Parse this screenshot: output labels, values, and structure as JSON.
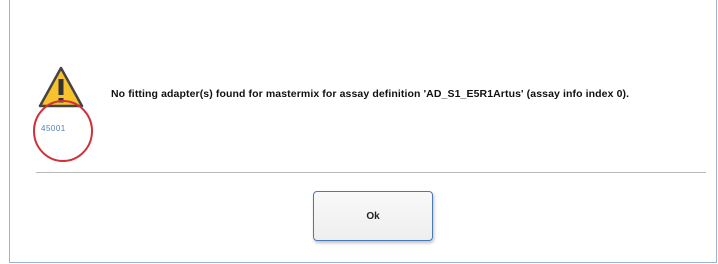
{
  "dialog": {
    "error_code": "45001",
    "message": "No fitting adapter(s) found for mastermix  for assay definition 'AD_S1_E5R1Artus' (assay info index 0).",
    "ok_label": "Ok"
  },
  "icon": "warning-triangle-icon",
  "colors": {
    "warning_fill": "#f7c22d",
    "highlight_circle": "#d0323a",
    "error_code_text": "#4a7fc0",
    "button_border": "#4a79b8"
  }
}
